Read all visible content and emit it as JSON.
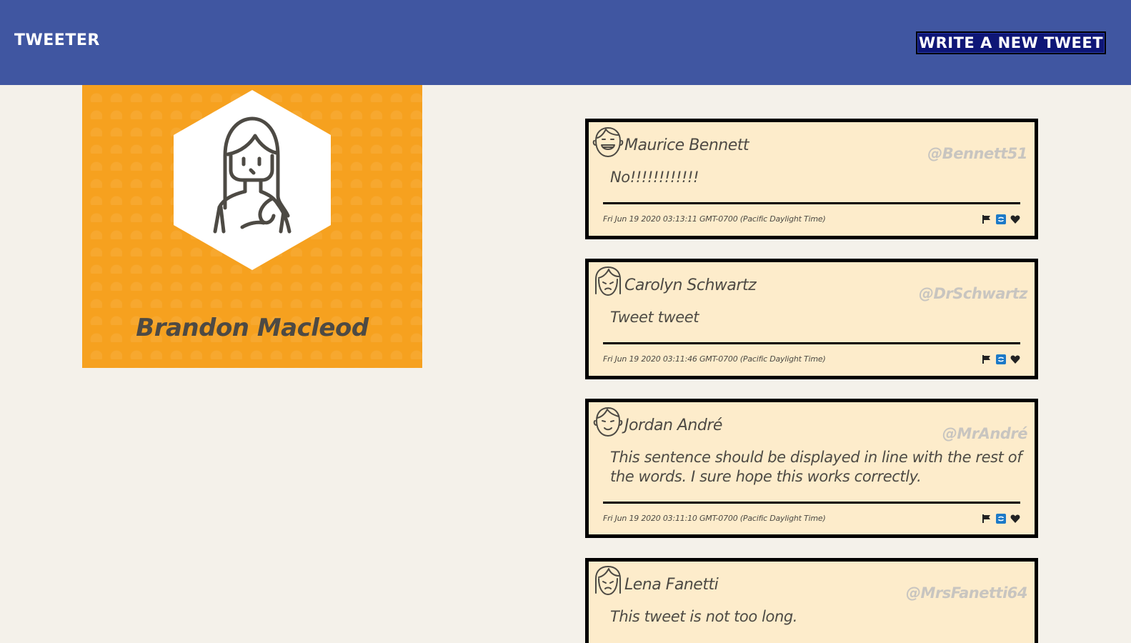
{
  "header": {
    "brand": "Tweeter",
    "compose_label": "Write a new tweet",
    "background": "#4056a1"
  },
  "profile": {
    "name": "Brandon Macleod",
    "avatar_icon": "woman-avatar-icon",
    "background": "#f6a11f"
  },
  "tweets": [
    {
      "name": "Maurice Bennett",
      "handle": "@Bennett51",
      "body": "No!!!!!!!!!!!!",
      "time": "Fri Jun 19 2020 03:13:11 GMT-0700 (Pacific Daylight Time)",
      "avatar_icon": "grinning-man-avatar-icon"
    },
    {
      "name": "Carolyn Schwartz",
      "handle": "@DrSchwartz",
      "body": "Tweet tweet",
      "time": "Fri Jun 19 2020 03:11:46 GMT-0700 (Pacific Daylight Time)",
      "avatar_icon": "woman-avatar-icon"
    },
    {
      "name": "Jordan André",
      "handle": "@MrAndré",
      "body": "This sentence should be displayed in line with the rest of the words. I sure hope this works correctly.",
      "time": "Fri Jun 19 2020 03:11:10 GMT-0700 (Pacific Daylight Time)",
      "avatar_icon": "man-avatar-icon"
    },
    {
      "name": "Lena Fanetti",
      "handle": "@MrsFanetti64",
      "body": "This tweet is not too long.",
      "time": "",
      "avatar_icon": "woman-avatar-icon"
    }
  ],
  "actions": {
    "flag_icon": "flag-icon",
    "retweet_icon": "retweet-icon",
    "like_icon": "heart-icon"
  }
}
